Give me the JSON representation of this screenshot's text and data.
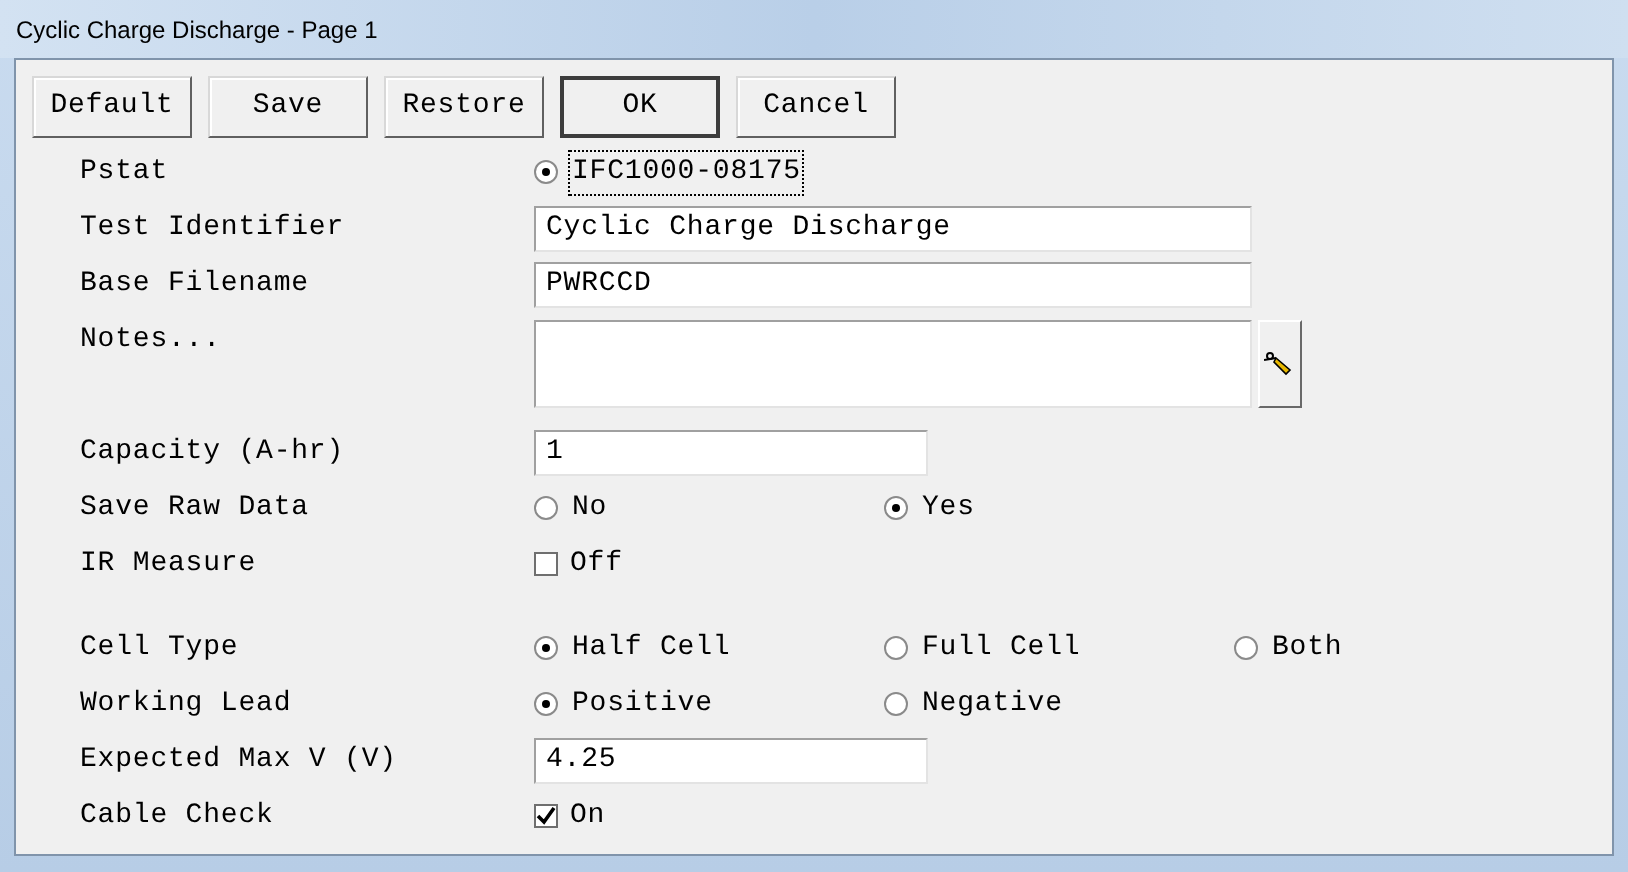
{
  "window": {
    "title": "Cyclic Charge Discharge - Page 1"
  },
  "buttons": [
    {
      "label": "Default",
      "default": false
    },
    {
      "label": "Save",
      "default": false
    },
    {
      "label": "Restore",
      "default": false
    },
    {
      "label": "OK",
      "default": true
    },
    {
      "label": "Cancel",
      "default": false
    }
  ],
  "sections": [
    {
      "rows": [
        {
          "kind": "radios",
          "label": "Pstat",
          "options": [
            {
              "label": "IFC1000-08175",
              "selected": true,
              "focused": true
            }
          ]
        },
        {
          "kind": "text",
          "label": "Test Identifier",
          "value": "Cyclic Charge Discharge",
          "wide": true
        },
        {
          "kind": "text",
          "label": "Base Filename",
          "value": "PWRCCD",
          "wide": true
        },
        {
          "kind": "notes",
          "label": "Notes..."
        },
        {
          "kind": "text",
          "label": "Capacity (A-hr)",
          "value": "1",
          "wide": false
        },
        {
          "kind": "radios",
          "label": "Save Raw Data",
          "options": [
            {
              "label": "No",
              "selected": false,
              "focused": false
            },
            {
              "label": "Yes",
              "selected": true,
              "focused": false
            }
          ]
        },
        {
          "kind": "checkbox",
          "label": "IR Measure",
          "option": "Off",
          "checked": false
        }
      ]
    },
    {
      "rows": [
        {
          "kind": "radios",
          "label": "Cell Type",
          "options": [
            {
              "label": "Half Cell",
              "selected": true,
              "focused": false
            },
            {
              "label": "Full Cell",
              "selected": false,
              "focused": false
            },
            {
              "label": "Both",
              "selected": false,
              "focused": false
            }
          ]
        },
        {
          "kind": "radios",
          "label": "Working Lead",
          "options": [
            {
              "label": "Positive",
              "selected": true,
              "focused": false
            },
            {
              "label": "Negative",
              "selected": false,
              "focused": false
            }
          ]
        },
        {
          "kind": "text",
          "label": "Expected Max V (V)",
          "value": "4.25",
          "wide": false
        },
        {
          "kind": "checkbox",
          "label": "Cable Check",
          "option": "On",
          "checked": true
        }
      ]
    }
  ]
}
